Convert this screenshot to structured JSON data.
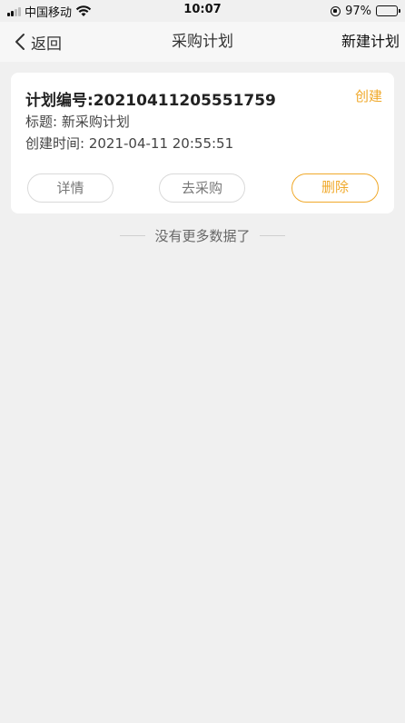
{
  "status_bar": {
    "carrier": "中国移动",
    "time": "10:07",
    "battery": "97%",
    "battery_level": 0.97
  },
  "nav": {
    "back_label": "返回",
    "title": "采购计划",
    "right_label": "新建计划"
  },
  "plans": [
    {
      "number": "计划编号:20210411205551759",
      "status": "创建",
      "title_line": "标题: 新采购计划",
      "created_line": "创建时间: 2021-04-11 20:55:51",
      "buttons": {
        "detail": "详情",
        "purchase": "去采购",
        "delete": "删除"
      }
    }
  ],
  "footer": {
    "no_more": "没有更多数据了"
  },
  "colors": {
    "accent": "#f0a92b",
    "background": "#f0f0f0",
    "battery": "#3ccd4b"
  }
}
